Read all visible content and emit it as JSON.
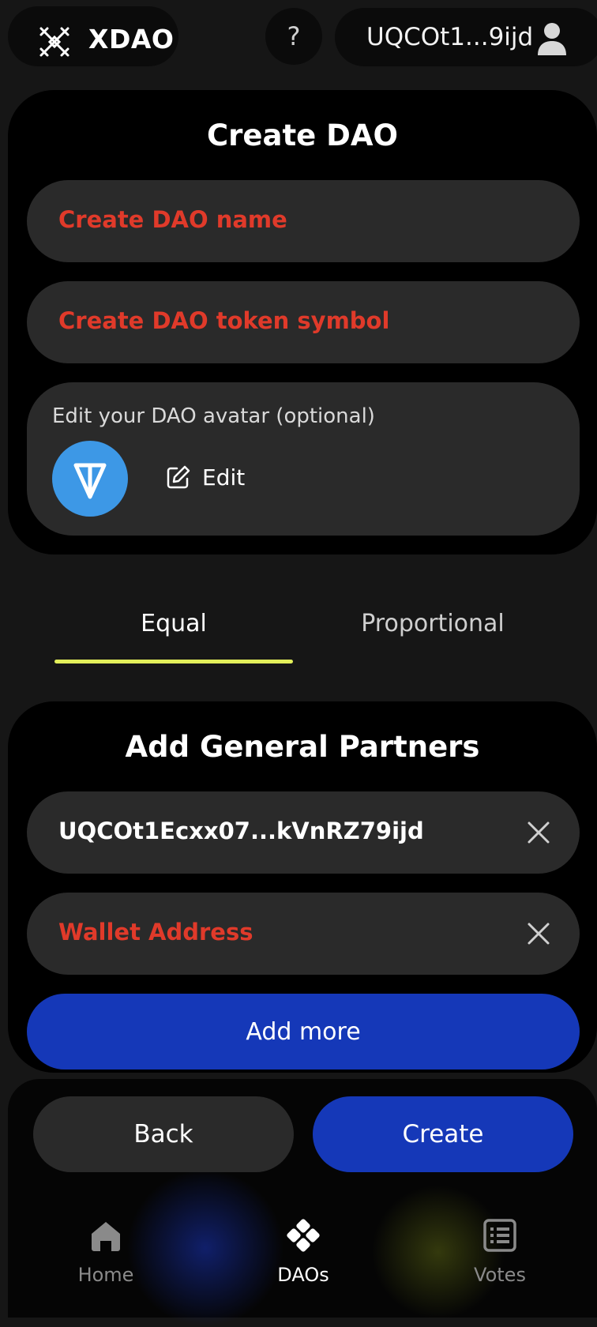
{
  "header": {
    "app_name": "XDAO",
    "help_label": "?",
    "wallet_short": "UQCOt1...9ijd"
  },
  "create_card": {
    "title": "Create DAO",
    "name_placeholder": "Create DAO name",
    "symbol_placeholder": "Create DAO token symbol",
    "avatar_label": "Edit your DAO avatar (optional)",
    "edit_label": "Edit"
  },
  "tabs": {
    "items": [
      {
        "label": "Equal",
        "active": true
      },
      {
        "label": "Proportional",
        "active": false
      }
    ],
    "underline_color": "#e2ef5a"
  },
  "partners_card": {
    "title": "Add General Partners",
    "partners": [
      {
        "value": "UQCOt1Ecxx07...kVnRZ79ijd",
        "placeholder": ""
      },
      {
        "value": "",
        "placeholder": "Wallet Address"
      }
    ],
    "add_more_label": "Add more"
  },
  "actions": {
    "back_label": "Back",
    "create_label": "Create"
  },
  "nav": {
    "items": [
      {
        "label": "Home",
        "icon": "home-icon",
        "active": false
      },
      {
        "label": "DAOs",
        "icon": "daos-icon",
        "active": true
      },
      {
        "label": "Votes",
        "icon": "votes-icon",
        "active": false
      }
    ]
  },
  "colors": {
    "background": "#161616",
    "card": "#000000",
    "field": "#2a2a2a",
    "placeholder_red": "#e03a2a",
    "primary_blue": "#1538b8",
    "ton_blue": "#3d98e6"
  }
}
